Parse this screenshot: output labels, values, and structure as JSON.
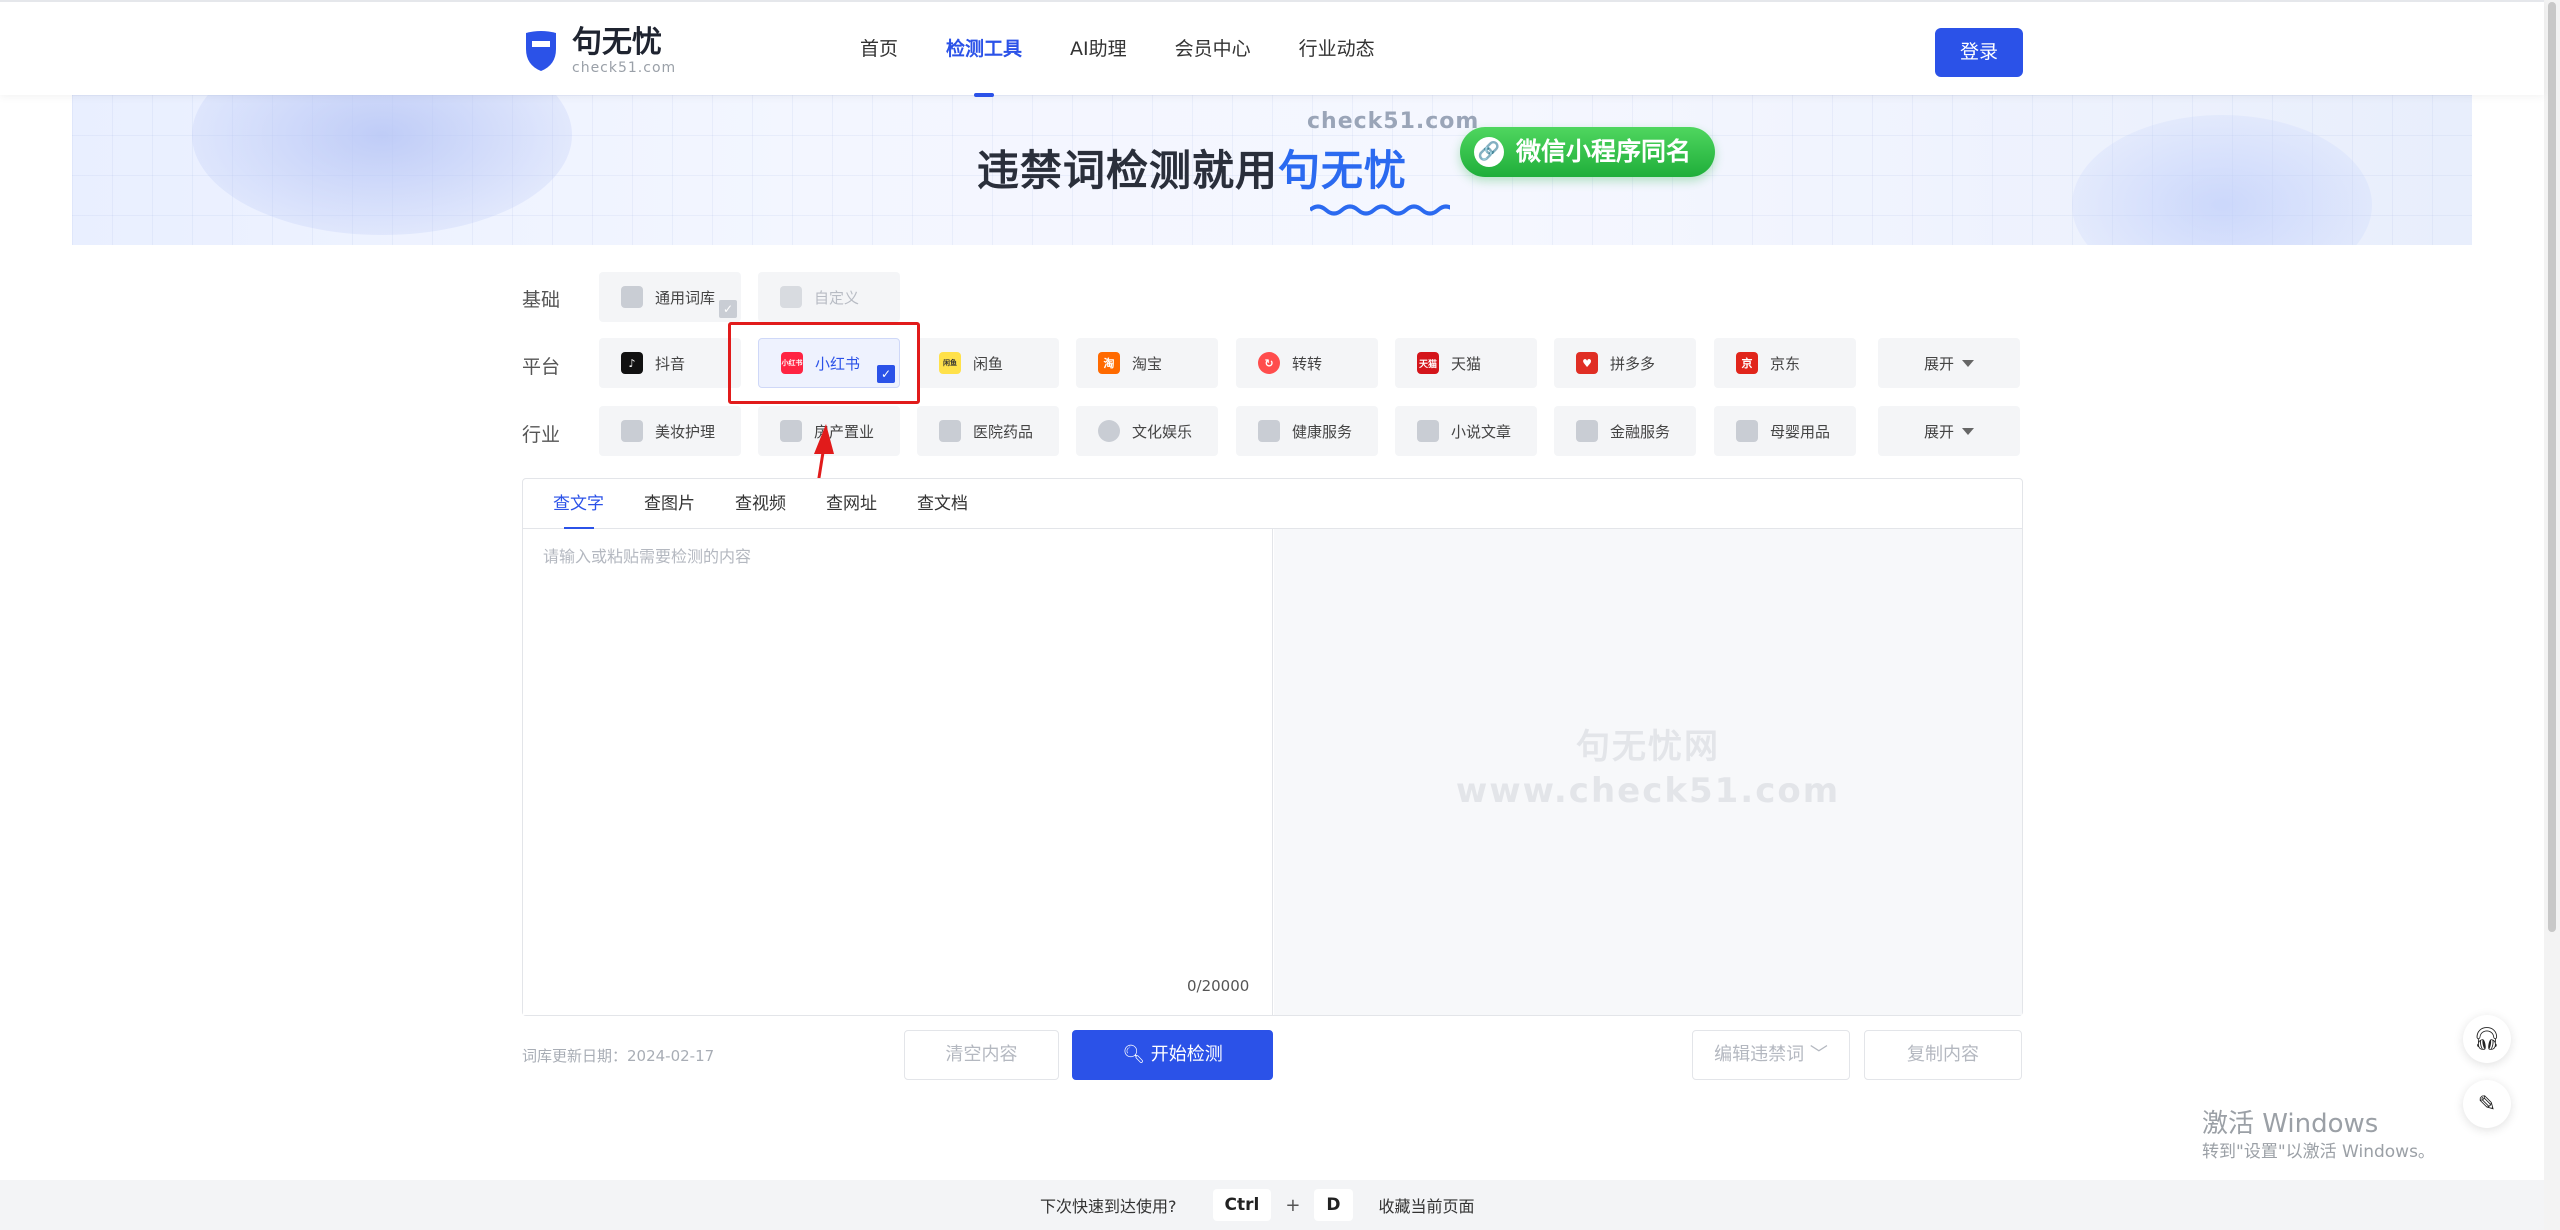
{
  "header": {
    "logo_name": "句无忧",
    "logo_domain": "check51.com",
    "nav": [
      "首页",
      "检测工具",
      "AI助理",
      "会员中心",
      "行业动态"
    ],
    "login": "登录"
  },
  "banner": {
    "domain": "check51.com",
    "title_prefix": "违禁词检测就用",
    "title_brand": "句无忧",
    "pill": "微信小程序同名"
  },
  "filters": {
    "basic_label": "基础",
    "basic": [
      "通用词库",
      "自定义"
    ],
    "platform_label": "平台",
    "platforms": [
      "抖音",
      "小红书",
      "闲鱼",
      "淘宝",
      "转转",
      "天猫",
      "拼多多",
      "京东"
    ],
    "platform_expand": "展开",
    "industry_label": "行业",
    "industries": [
      "美妆护理",
      "房产置业",
      "医院药品",
      "文化娱乐",
      "健康服务",
      "小说文章",
      "金融服务",
      "母婴用品"
    ],
    "industry_expand": "展开",
    "icon_xhs_text": "小红书",
    "icon_xianyu_text": "闲鱼",
    "icon_tmall_text": "天猫"
  },
  "panel": {
    "tabs": [
      "查文字",
      "查图片",
      "查视频",
      "查网址",
      "查文档"
    ],
    "placeholder": "请输入或粘贴需要检测的内容",
    "counter": "0/20000",
    "watermark_line1": "句无忧网",
    "watermark_line2": "www.check51.com"
  },
  "actions": {
    "update_date": "词库更新日期：2024-02-17",
    "clear": "清空内容",
    "start": "开始检测",
    "edit_words": "编辑违禁词",
    "copy": "复制内容"
  },
  "windows": {
    "line1": "激活 Windows",
    "line2": "转到\"设置\"以激活 Windows。"
  },
  "bookmark_bar": {
    "prompt": "下次快速到达使用?",
    "key1": "Ctrl",
    "plus": "+",
    "key2": "D",
    "action": "收藏当前页面"
  },
  "colors": {
    "primary": "#2b52e8",
    "highlight": "#e11b1b",
    "wechat_green": "#1fae3a"
  }
}
